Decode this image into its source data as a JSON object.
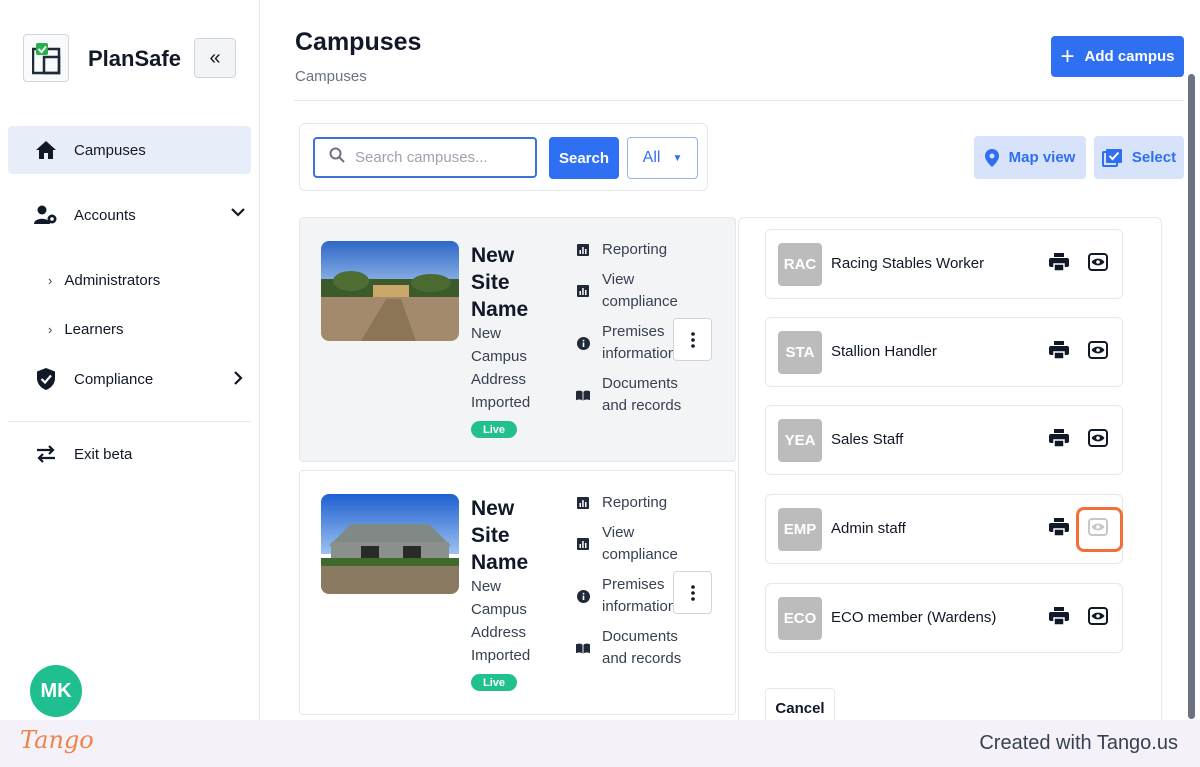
{
  "app": {
    "brand": "PlanSafe"
  },
  "sidebar": {
    "collapse_label": "«",
    "items": [
      {
        "label": "Campuses",
        "icon": "home-icon"
      },
      {
        "label": "Accounts",
        "icon": "users-gear-icon"
      },
      {
        "label": "Compliance",
        "icon": "shield-check-icon"
      },
      {
        "label": "Exit beta",
        "icon": "swap-arrows-icon"
      }
    ],
    "sub_items": [
      {
        "label": "Administrators"
      },
      {
        "label": "Learners"
      }
    ],
    "sub_arrow": "›",
    "user_initials": "MK"
  },
  "header": {
    "title": "Campuses",
    "breadcrumb": "Campuses",
    "add_button": "Add campus",
    "add_plus": "+"
  },
  "search": {
    "placeholder": "Search campuses...",
    "button": "Search",
    "filter_value": "All"
  },
  "actions": {
    "map_view": "Map view",
    "select": "Select"
  },
  "campuses": [
    {
      "name": "New Site Name",
      "address": "New Campus Address Imported",
      "status": "Live",
      "links": [
        "Reporting",
        "View compliance",
        "Premises information",
        "Documents and records"
      ]
    },
    {
      "name": "New Site Name",
      "address": "New Campus Address Imported",
      "status": "Live",
      "links": [
        "Reporting",
        "View compliance",
        "Premises information",
        "Documents and records"
      ]
    }
  ],
  "roles": [
    {
      "abbr": "RAC",
      "name": "Racing Stables Worker"
    },
    {
      "abbr": "STA",
      "name": "Stallion Handler"
    },
    {
      "abbr": "YEA",
      "name": "Sales Staff"
    },
    {
      "abbr": "EMP",
      "name": "Admin staff"
    },
    {
      "abbr": "ECO",
      "name": "ECO member (Wardens)"
    }
  ],
  "panel": {
    "cancel": "Cancel"
  },
  "footer": {
    "logo": "Tango",
    "created": "Created with Tango.us"
  },
  "colors": {
    "primary": "#2f6ff1",
    "live": "#22c08f",
    "highlight": "#f26f3a",
    "avatar": "#1fbf8f"
  }
}
